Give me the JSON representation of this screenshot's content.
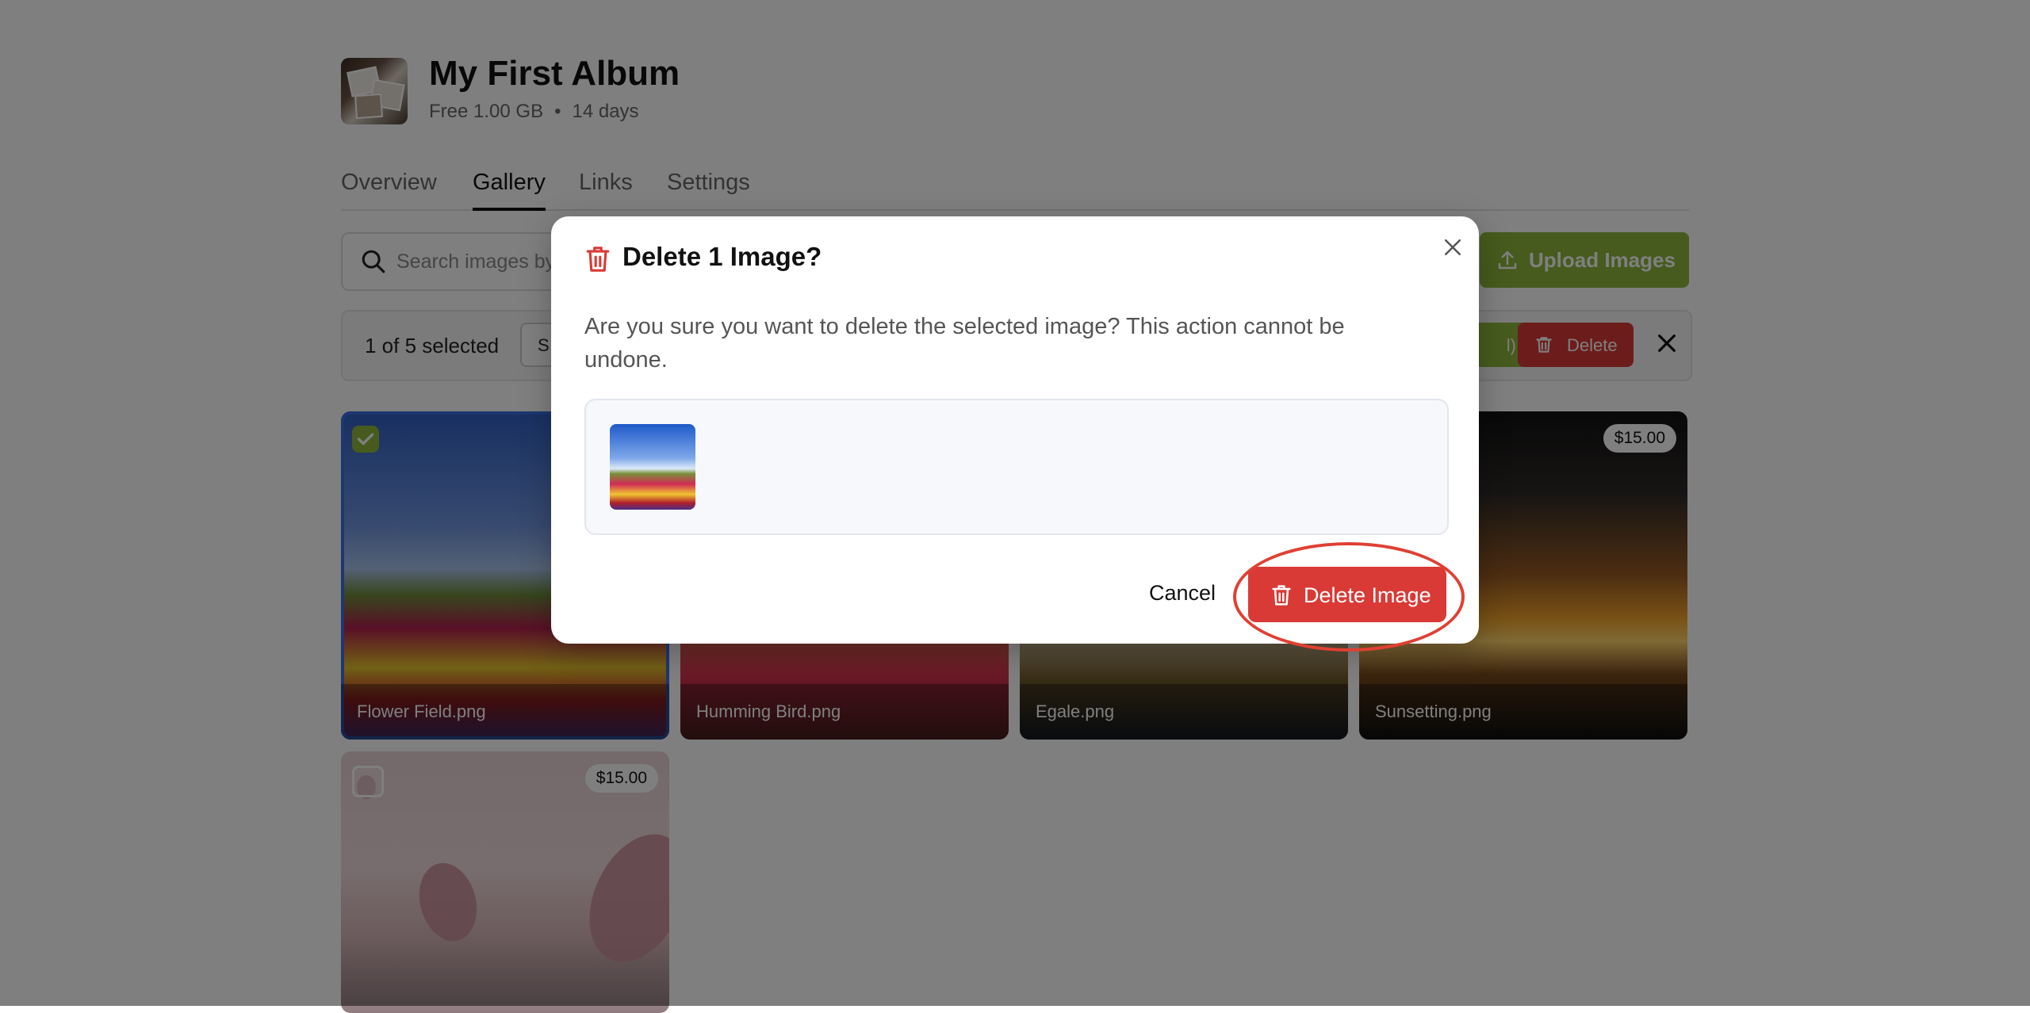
{
  "album": {
    "title": "My First Album",
    "plan": "Free 1.00 GB",
    "duration": "14 days"
  },
  "tabs": [
    {
      "label": "Overview"
    },
    {
      "label": "Gallery"
    },
    {
      "label": "Links"
    },
    {
      "label": "Settings"
    }
  ],
  "toolbar": {
    "search_placeholder": "Search images by",
    "upload_label": "Upload Images"
  },
  "selection": {
    "count_text": "1 of 5 selected",
    "select_all_label": "S",
    "green_pill_label": "l)",
    "delete_label": "Delete"
  },
  "images": [
    {
      "name": "Flower Field.png"
    },
    {
      "name": "Humming Bird.png"
    },
    {
      "name": "Egale.png"
    },
    {
      "name": "Sunsetting.png",
      "price": "$15.00"
    },
    {
      "price": "$15.00"
    }
  ],
  "modal": {
    "title": "Delete 1 Image?",
    "message": "Are you sure you want to delete the selected image? This action cannot be undone.",
    "cancel_label": "Cancel",
    "confirm_label": "Delete Image"
  },
  "colors": {
    "accent_green": "#8db63a",
    "danger_red": "#d93a36",
    "highlight_ring": "#e04033"
  }
}
